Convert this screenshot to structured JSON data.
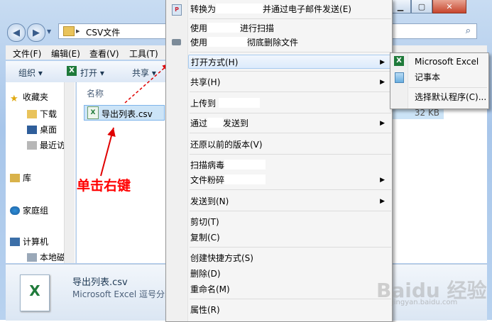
{
  "window": {
    "path_label": "CSV文件",
    "menu": [
      "文件(F)",
      "编辑(E)",
      "查看(V)",
      "工具(T)"
    ],
    "toolbar": {
      "organize": "组织 ▾",
      "open": "打开 ▾",
      "share": "共享 ▾"
    },
    "nav_pane": [
      {
        "label": "收藏夹",
        "icon": "star-icon"
      },
      {
        "label": "下载",
        "icon": "folder-download-icon"
      },
      {
        "label": "桌面",
        "icon": "desktop-icon"
      },
      {
        "label": "最近访",
        "icon": "recent-places-icon"
      },
      {
        "label": "库",
        "icon": "library-icon"
      },
      {
        "label": "家庭组",
        "icon": "homegroup-icon"
      },
      {
        "label": "计算机",
        "icon": "computer-icon"
      },
      {
        "label": "本地磁",
        "icon": "drive-icon"
      }
    ],
    "column_name": "名称",
    "file": {
      "name": "导出列表.csv",
      "size": "32 KB"
    },
    "details": {
      "name": "导出列表.csv",
      "type": "Microsoft Excel 逗号分隔"
    }
  },
  "context_menu": {
    "convert": {
      "prefix": "转换为",
      "suffix": "并通过电子邮件发送(E)"
    },
    "scan": {
      "prefix": "使用",
      "suffix": "进行扫描"
    },
    "shred": {
      "prefix": "使用",
      "suffix": "彻底删除文件"
    },
    "open_with": "打开方式(H)",
    "share": "共享(H)",
    "upload": "上传到",
    "send_via": {
      "prefix": "通过",
      "suffix": "发送到"
    },
    "restore": "还原以前的版本(V)",
    "virus_scan": "扫描病毒",
    "file_shredder": "文件粉碎",
    "send_to": "发送到(N)",
    "cut": "剪切(T)",
    "copy": "复制(C)",
    "create_shortcut": "创建快捷方式(S)",
    "delete": "删除(D)",
    "rename": "重命名(M)",
    "properties": "属性(R)"
  },
  "submenu": {
    "excel": "Microsoft Excel",
    "notepad": "记事本",
    "choose_default": "选择默认程序(C)..."
  },
  "annotation": "单击右键",
  "watermark": "Baidu 经验",
  "watermark_url": "jingyan.baidu.com",
  "colors": {
    "annotation": "#ff0000",
    "highlight": "#cce4f7"
  }
}
